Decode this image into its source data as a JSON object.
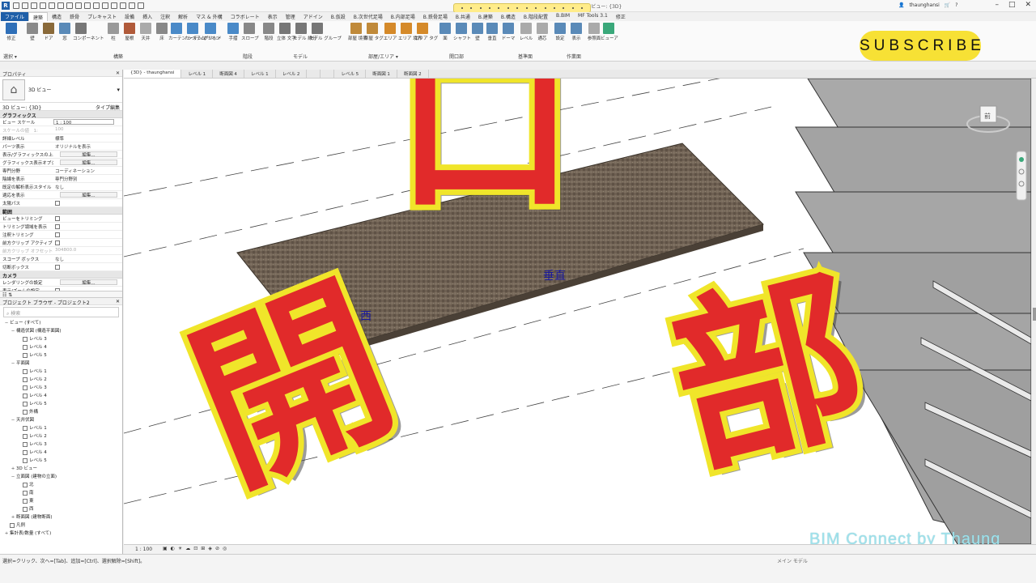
{
  "quick_access": {
    "logo": "R"
  },
  "window": {
    "title": "3D ビュー: {3D}",
    "user": "thaunghansi"
  },
  "ribbon_tabs": [
    "ファイル",
    "建築",
    "構造",
    "鉄骨",
    "プレキャスト",
    "設備",
    "挿入",
    "注釈",
    "解析",
    "マス & 外構",
    "コラボレート",
    "表示",
    "管理",
    "アドイン",
    "B.仮設",
    "B.次世代足場",
    "B.内部足場",
    "B.鉄骨足場",
    "B.共通",
    "B.建築",
    "B.構造",
    "B.階段配置",
    "B.BIM",
    "MF Tools 3.1",
    "修正"
  ],
  "ribbon": {
    "select_label": "選択 ▾",
    "tools": [
      {
        "name": "modify",
        "label": "修正",
        "color": "#2f6fb8"
      },
      {
        "name": "wall",
        "label": "壁",
        "color": "#8a8a8a"
      },
      {
        "name": "door",
        "label": "ドア",
        "color": "#8a6a3a"
      },
      {
        "name": "window",
        "label": "窓",
        "color": "#5a8ab8"
      },
      {
        "name": "component",
        "label": "コンポーネント",
        "color": "#777"
      },
      {
        "name": "column",
        "label": "柱",
        "color": "#999"
      },
      {
        "name": "roof",
        "label": "屋根",
        "color": "#b05a3a"
      },
      {
        "name": "ceiling",
        "label": "天井",
        "color": "#aaa"
      },
      {
        "name": "floor",
        "label": "床",
        "color": "#888"
      },
      {
        "name": "curtain-system",
        "label": "カーテン システム",
        "color": "#4a8ac8"
      },
      {
        "name": "curtain-grid",
        "label": "カーテン グリッド",
        "color": "#4a8ac8"
      },
      {
        "name": "mullion",
        "label": "マリオン",
        "color": "#4a8ac8"
      },
      {
        "name": "railing",
        "label": "手摺",
        "color": "#4a8ac8"
      },
      {
        "name": "ramp",
        "label": "スロープ",
        "color": "#888"
      },
      {
        "name": "stair",
        "label": "階段",
        "color": "#888"
      },
      {
        "name": "model-text",
        "label": "立体 文字",
        "color": "#777"
      },
      {
        "name": "model-line",
        "label": "モデル 線分",
        "color": "#777"
      },
      {
        "name": "model-group",
        "label": "モデル グループ",
        "color": "#777"
      },
      {
        "name": "room-separator",
        "label": "部屋 境界",
        "color": "#c08a3a"
      },
      {
        "name": "room-tag",
        "label": "部屋 タグ",
        "color": "#c08a3a"
      },
      {
        "name": "area",
        "label": "エリア",
        "color": "#d58a2a"
      },
      {
        "name": "area-boundary",
        "label": "エリア 境界",
        "color": "#d58a2a"
      },
      {
        "name": "area-tag",
        "label": "エリア タグ",
        "color": "#d58a2a"
      },
      {
        "name": "face",
        "label": "面",
        "color": "#5a8ab8"
      },
      {
        "name": "shaft",
        "label": "シャフト",
        "color": "#5a8ab8"
      },
      {
        "name": "wall-opening",
        "label": "壁",
        "color": "#5a8ab8"
      },
      {
        "name": "vertical",
        "label": "垂直",
        "color": "#5a8ab8"
      },
      {
        "name": "dormer",
        "label": "ドーマ",
        "color": "#5a8ab8"
      },
      {
        "name": "level",
        "label": "レベル",
        "color": "#aaa"
      },
      {
        "name": "grid",
        "label": "通芯",
        "color": "#aaa"
      },
      {
        "name": "set",
        "label": "設定",
        "color": "#5a8ab8"
      },
      {
        "name": "show",
        "label": "表示",
        "color": "#5a8ab8"
      },
      {
        "name": "ref-plane",
        "label": "参照面",
        "color": "#aaa"
      },
      {
        "name": "viewer",
        "label": "ビューア",
        "color": "#3aa87a"
      }
    ],
    "panels": [
      "構築",
      "階段",
      "モデル",
      "部屋/エリア ▾",
      "開口部",
      "基準面",
      "作業面"
    ]
  },
  "subscribe": "SUBSCRIBE",
  "properties": {
    "header": "プロパティ",
    "type_name": "3D ビュー",
    "view_select": "3D ビュー: {3D}",
    "edit_type": "タイプ編集",
    "sections": [
      {
        "title": "グラフィックス",
        "rows": [
          {
            "k": "ビュー スケール",
            "v": "1 : 100",
            "kind": "box"
          },
          {
            "k": "スケールの値　1:",
            "v": "100",
            "kind": "dim"
          },
          {
            "k": "詳細レベル",
            "v": "標準"
          },
          {
            "k": "パーツ表示",
            "v": "オリジナルを表示"
          },
          {
            "k": "表示/グラフィックスの上...",
            "v": "編集...",
            "kind": "btn"
          },
          {
            "k": "グラフィックス表示オプション",
            "v": "編集...",
            "kind": "btn"
          },
          {
            "k": "専門分野",
            "v": "コーディネーション"
          },
          {
            "k": "陰線を表示",
            "v": "専門分野別"
          },
          {
            "k": "既定の解析表示スタイル",
            "v": "なし"
          },
          {
            "k": "適応を表示",
            "v": "編集...",
            "kind": "btn"
          },
          {
            "k": "太陽パス",
            "v": "",
            "kind": "chk"
          }
        ]
      },
      {
        "title": "範囲",
        "rows": [
          {
            "k": "ビューをトリミング",
            "v": "",
            "kind": "chk"
          },
          {
            "k": "トリミング領域を表示",
            "v": "",
            "kind": "chk"
          },
          {
            "k": "注釈トリミング",
            "v": "",
            "kind": "chk"
          },
          {
            "k": "前方クリップ アクティブ",
            "v": "",
            "kind": "chk"
          },
          {
            "k": "前方クリップ オフセット",
            "v": "304800.0",
            "kind": "dim"
          },
          {
            "k": "スコープ ボックス",
            "v": "なし"
          },
          {
            "k": "切断ボックス",
            "v": "",
            "kind": "chk"
          }
        ]
      },
      {
        "title": "カメラ",
        "rows": [
          {
            "k": "レンダリングの設定",
            "v": "編集...",
            "kind": "btn"
          },
          {
            "k": "表示/ズームの設定",
            "v": "",
            "kind": "chk"
          }
        ]
      }
    ]
  },
  "browser": {
    "header": "プロジェクト ブラウザ - プロジェクト2",
    "search_placeholder": "検索",
    "tree": [
      {
        "lvl": 0,
        "tg": "−",
        "t": "ビュー (すべて)"
      },
      {
        "lvl": 1,
        "tg": "−",
        "t": "構造伏図 (構造平面図)"
      },
      {
        "lvl": 2,
        "tg": "",
        "t": "レベル 3",
        "icon": true
      },
      {
        "lvl": 2,
        "tg": "",
        "t": "レベル 4",
        "icon": true
      },
      {
        "lvl": 2,
        "tg": "",
        "t": "レベル 5",
        "icon": true
      },
      {
        "lvl": 1,
        "tg": "−",
        "t": "平面図"
      },
      {
        "lvl": 2,
        "tg": "",
        "t": "レベル 1",
        "icon": true
      },
      {
        "lvl": 2,
        "tg": "",
        "t": "レベル 2",
        "icon": true
      },
      {
        "lvl": 2,
        "tg": "",
        "t": "レベル 3",
        "icon": true
      },
      {
        "lvl": 2,
        "tg": "",
        "t": "レベル 4",
        "icon": true
      },
      {
        "lvl": 2,
        "tg": "",
        "t": "レベル 5",
        "icon": true
      },
      {
        "lvl": 2,
        "tg": "",
        "t": "外構",
        "icon": true
      },
      {
        "lvl": 1,
        "tg": "−",
        "t": "天井伏図"
      },
      {
        "lvl": 2,
        "tg": "",
        "t": "レベル 1",
        "icon": true
      },
      {
        "lvl": 2,
        "tg": "",
        "t": "レベル 2",
        "icon": true
      },
      {
        "lvl": 2,
        "tg": "",
        "t": "レベル 3",
        "icon": true
      },
      {
        "lvl": 2,
        "tg": "",
        "t": "レベル 4",
        "icon": true
      },
      {
        "lvl": 2,
        "tg": "",
        "t": "レベル 5",
        "icon": true
      },
      {
        "lvl": 1,
        "tg": "+",
        "t": "3D ビュー"
      },
      {
        "lvl": 1,
        "tg": "−",
        "t": "立面図 (建物の立面)"
      },
      {
        "lvl": 2,
        "tg": "",
        "t": "北",
        "icon": true
      },
      {
        "lvl": 2,
        "tg": "",
        "t": "南",
        "icon": true
      },
      {
        "lvl": 2,
        "tg": "",
        "t": "東",
        "icon": true
      },
      {
        "lvl": 2,
        "tg": "",
        "t": "西",
        "icon": true
      },
      {
        "lvl": 1,
        "tg": "+",
        "t": "断面図 (建物断面)"
      },
      {
        "lvl": 0,
        "tg": "",
        "t": "凡例",
        "icon": true
      },
      {
        "lvl": 0,
        "tg": "+",
        "t": "集計表/数量 (すべて)"
      }
    ]
  },
  "doc_tabs": [
    "{3D} - thaunghansi",
    "レベル 1",
    "断面図 4",
    "レベル 1",
    "レベル 2",
    "",
    "",
    "レベル 5",
    "断面図 1",
    "断面図 2"
  ],
  "viewport": {
    "label_west": "西",
    "label_vertical": "垂直",
    "viewcube_face": "前",
    "overlay_chars": [
      "開",
      "口",
      "部"
    ]
  },
  "view_bar": {
    "scale": "1 : 100"
  },
  "status": {
    "text": "選択=クリック、次へ=[Tab]、追加=[Ctrl]、選択解除=[Shift]。",
    "model": "メイン モデル"
  },
  "watermark": "BIM Connect by Thaung"
}
